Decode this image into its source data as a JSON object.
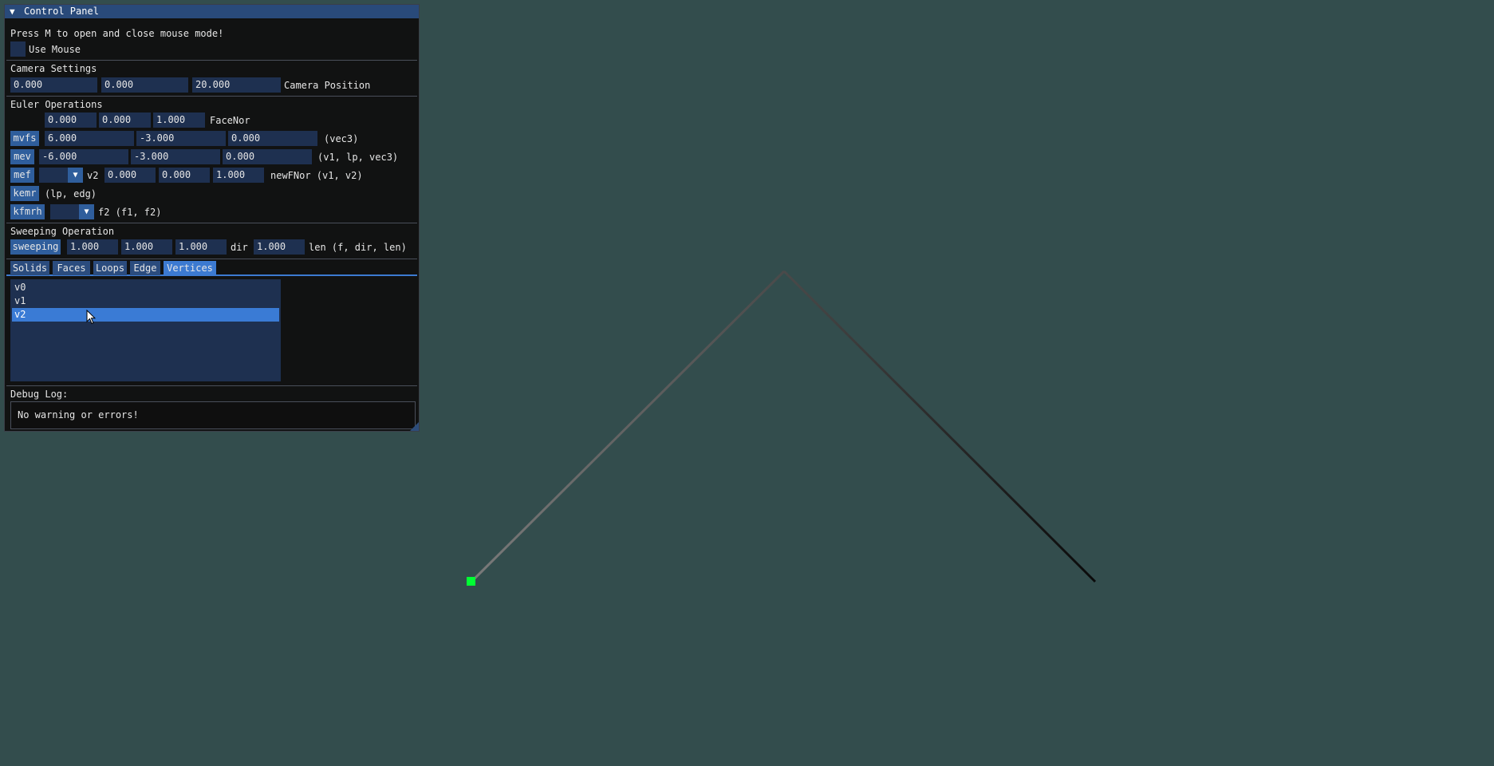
{
  "window": {
    "title": "Control Panel",
    "collapse_arrow": "▼"
  },
  "header": {
    "hint": "Press M to open and close mouse mode!",
    "use_mouse_label": "Use Mouse",
    "use_mouse_checked": false
  },
  "camera": {
    "section_title": "Camera Settings",
    "x": "0.000",
    "y": "0.000",
    "z": "20.000",
    "label": "Camera Position"
  },
  "euler": {
    "section_title": "Euler Operations",
    "face_normal": {
      "x": "0.000",
      "y": "0.000",
      "z": "1.000",
      "label": "FaceNor"
    },
    "mvfs": {
      "button": "mvfs",
      "x": "6.000",
      "y": "-3.000",
      "z": "0.000",
      "signature": "(vec3)"
    },
    "mev": {
      "button": "mev",
      "x": "-6.000",
      "y": "-3.000",
      "z": "0.000",
      "signature": "(v1, lp, vec3)"
    },
    "mef": {
      "button": "mef",
      "combo_value": "",
      "combo_label": "v2",
      "x": "0.000",
      "y": "0.000",
      "z": "1.000",
      "signature": "newFNor (v1, v2)"
    },
    "kemr": {
      "button": "kemr",
      "signature": "(lp, edg)"
    },
    "kfmrh": {
      "button": "kfmrh",
      "combo_value": "",
      "signature": "f2 (f1, f2)"
    }
  },
  "sweeping": {
    "section_title": "Sweeping Operation",
    "button": "sweeping",
    "x": "1.000",
    "y": "1.000",
    "z": "1.000",
    "dir_label": "dir",
    "len": "1.000",
    "signature": "len (f, dir, len)"
  },
  "tabs": [
    {
      "label": "Solids",
      "active": false
    },
    {
      "label": "Faces",
      "active": false
    },
    {
      "label": "Loops",
      "active": false
    },
    {
      "label": "Edge",
      "active": false
    },
    {
      "label": "Vertices",
      "active": true
    }
  ],
  "vertices": [
    {
      "label": "v0",
      "selected": false
    },
    {
      "label": "v1",
      "selected": false
    },
    {
      "label": "v2",
      "selected": true
    }
  ],
  "debug": {
    "label": "Debug Log:",
    "message": "No warning or errors!"
  },
  "colors": {
    "viewport_bg": "#334d4d",
    "vertex_marker": "#00ff33",
    "title_bar": "#294a7a",
    "selection": "#3a7bd5"
  }
}
